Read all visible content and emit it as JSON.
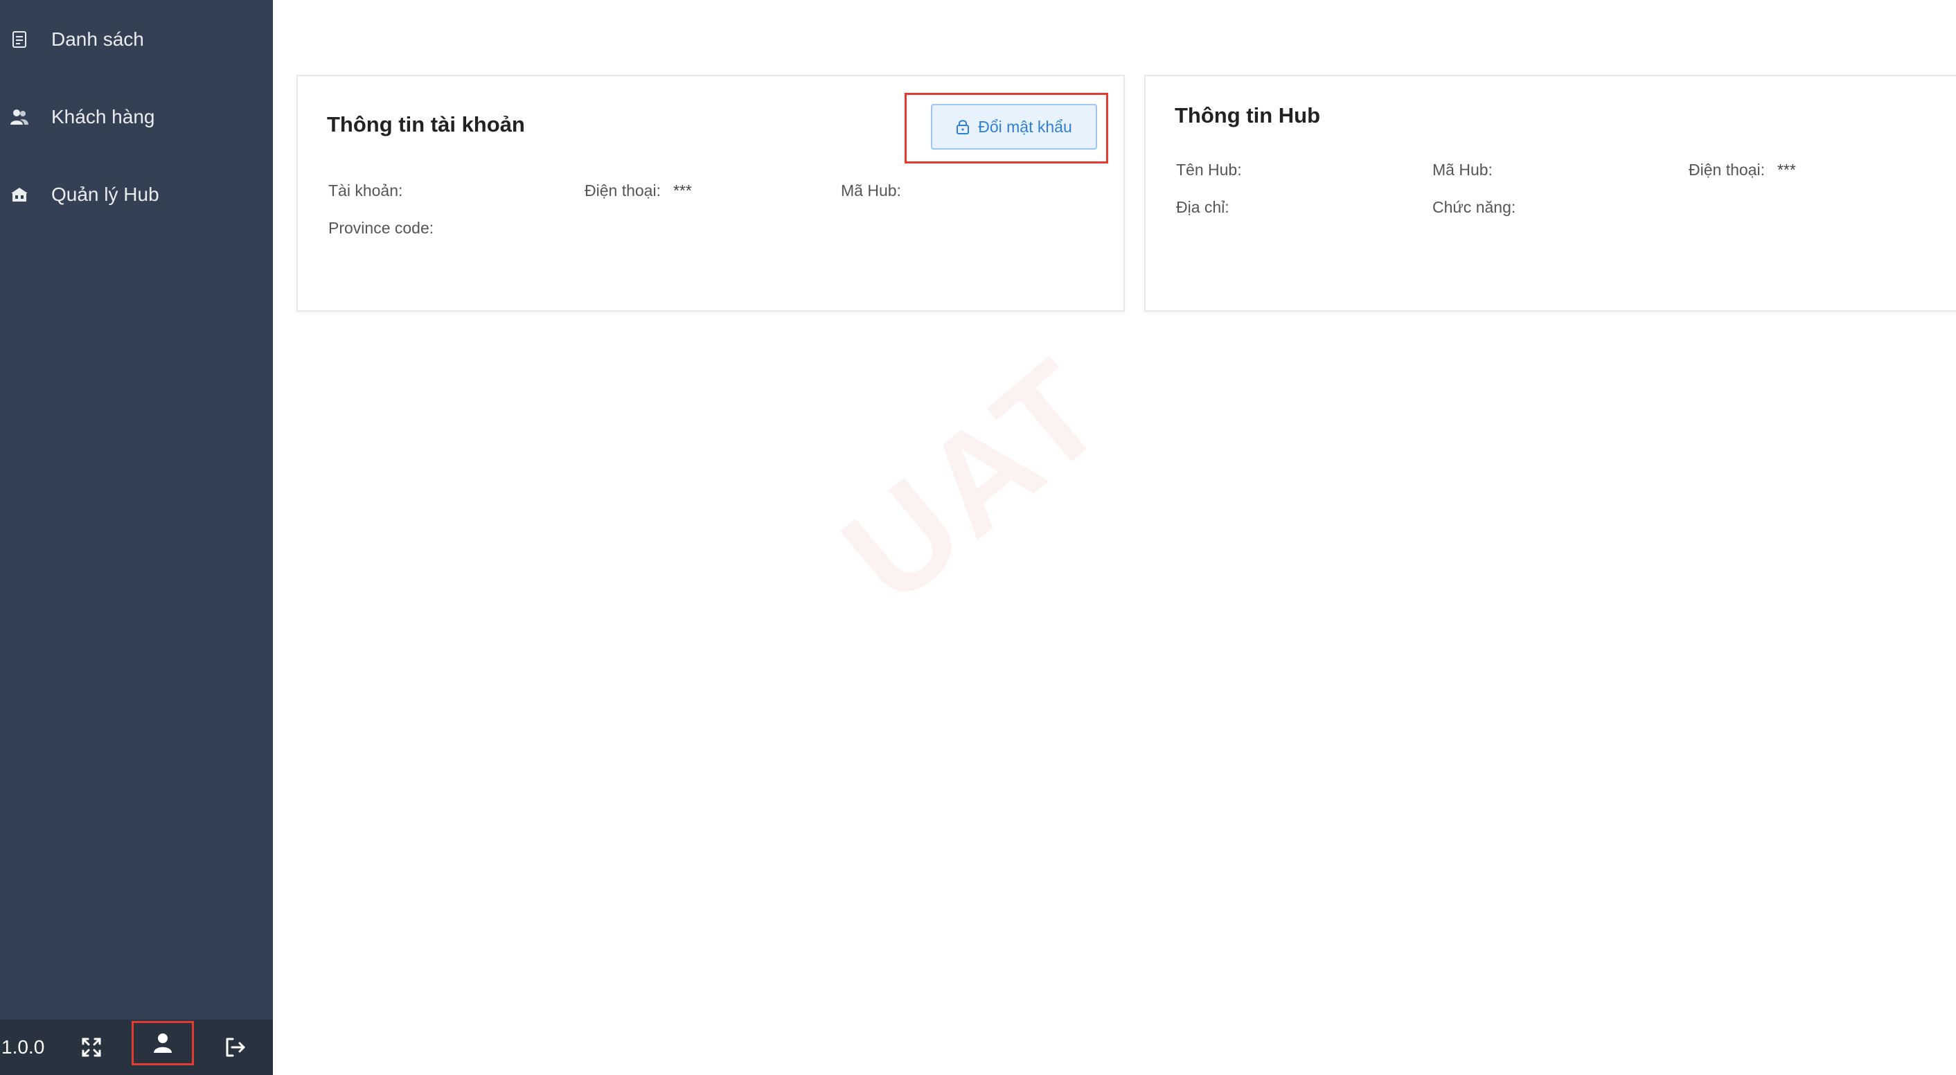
{
  "sidebar": {
    "items": [
      {
        "label": "Danh sách",
        "icon": "list-icon"
      },
      {
        "label": "Khách hàng",
        "icon": "users-icon"
      },
      {
        "label": "Quản lý Hub",
        "icon": "hub-building-icon"
      }
    ],
    "footer": {
      "version": "1.0.0"
    }
  },
  "account_card": {
    "title": "Thông tin tài khoản",
    "change_password_label": "Đổi mật khẩu",
    "fields": {
      "account_label": "Tài khoản:",
      "phone_label": "Điện thoại:",
      "phone_value": "***",
      "hub_code_label": "Mã Hub:",
      "province_label": "Province code:"
    }
  },
  "hub_card": {
    "title": "Thông tin Hub",
    "fields": {
      "hub_name_label": "Tên Hub:",
      "hub_code_label": "Mã Hub:",
      "phone_label": "Điện thoại:",
      "phone_value": "***",
      "address_label": "Địa chỉ:",
      "function_label": "Chức năng:"
    }
  },
  "watermark": "UAT",
  "colors": {
    "sidebar_bg": "#344154",
    "footer_bg": "#28333f",
    "highlight": "#e53a2f",
    "primary": "#2f7ed8"
  }
}
